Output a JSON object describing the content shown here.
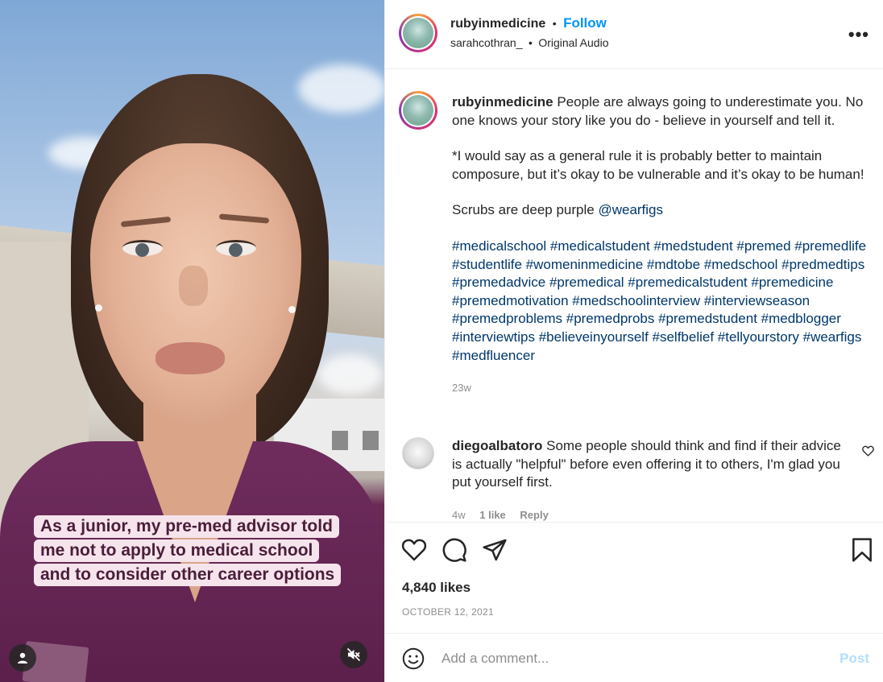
{
  "media": {
    "caption_lines": [
      "As a junior, my pre-med advisor told",
      "me not to apply to medical school",
      "and to consider other career options"
    ],
    "user_icon": "user-icon",
    "mute_icon": "muted-speaker-icon"
  },
  "header": {
    "username": "rubyinmedicine",
    "separator": "•",
    "follow_label": "Follow",
    "audio_user": "sarahcothran_",
    "audio_separator": "•",
    "audio_label": "Original Audio",
    "more_label": "•••"
  },
  "post": {
    "username": "rubyinmedicine",
    "text_1": "People are always going to underestimate you. No one knows your story like you do - believe in yourself and tell it.",
    "text_2": "*I would say as a general rule it is probably better to maintain composure, but it’s okay to be vulnerable and it’s okay to be human!",
    "text_3_prefix": "Scrubs are deep purple ",
    "mention": "@wearfigs",
    "hashtags": "#medicalschool #medicalstudent #medstudent #premed #premedlife #studentlife #womeninmedicine #mdtobe #medschool #predmedtips #premedadvice #premedical #premedicalstudent #premedicine #premedmotivation #medschoolinterview #interviewseason #premedproblems #premedprobs #premedstudent #medblogger #interviewtips #believeinyourself #selfbelief #tellyourstory #wearfigs #medfluencer",
    "time": "23w"
  },
  "comment": {
    "username": "diegoalbatoro",
    "text": "Some people should think and find if their advice is actually \"helpful\" before even offering it to others, I'm glad you put yourself first.",
    "time": "4w",
    "likes": "1 like",
    "reply": "Reply"
  },
  "actions": {
    "likes": "4,840 likes",
    "date": "OCTOBER 12, 2021"
  },
  "add_comment": {
    "placeholder": "Add a comment...",
    "post_label": "Post"
  },
  "colors": {
    "link_blue": "#0095f6",
    "hashtag": "#00376b",
    "post_disabled": "#b2dffc",
    "secondary_text": "#8e8e8e"
  }
}
